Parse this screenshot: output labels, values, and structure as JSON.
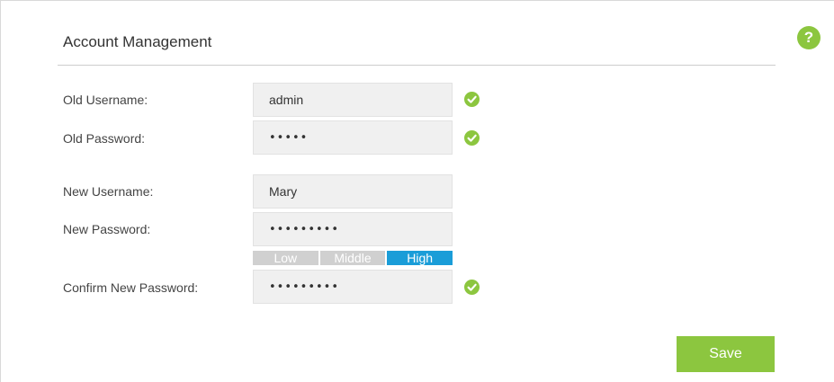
{
  "help": {
    "icon": "help-circle-icon",
    "glyph": "?"
  },
  "section": {
    "title": "Account Management"
  },
  "fields": {
    "old_username": {
      "label": "Old Username:",
      "value": "admin",
      "valid": true
    },
    "old_password": {
      "label": "Old Password:",
      "value": "•••••",
      "valid": true
    },
    "new_username": {
      "label": "New Username:",
      "value": "Mary"
    },
    "new_password": {
      "label": "New Password:",
      "value": "•••••••••"
    },
    "confirm_password": {
      "label": "Confirm New Password:",
      "value": "•••••••••",
      "valid": true
    }
  },
  "strength": {
    "levels": [
      "Low",
      "Middle",
      "High"
    ],
    "current": "High"
  },
  "actions": {
    "save_label": "Save"
  },
  "colors": {
    "accent_green": "#8cc63f",
    "strength_active": "#1a9dd8",
    "strength_inactive": "#d0d0d0",
    "input_bg": "#f0f0f0"
  }
}
